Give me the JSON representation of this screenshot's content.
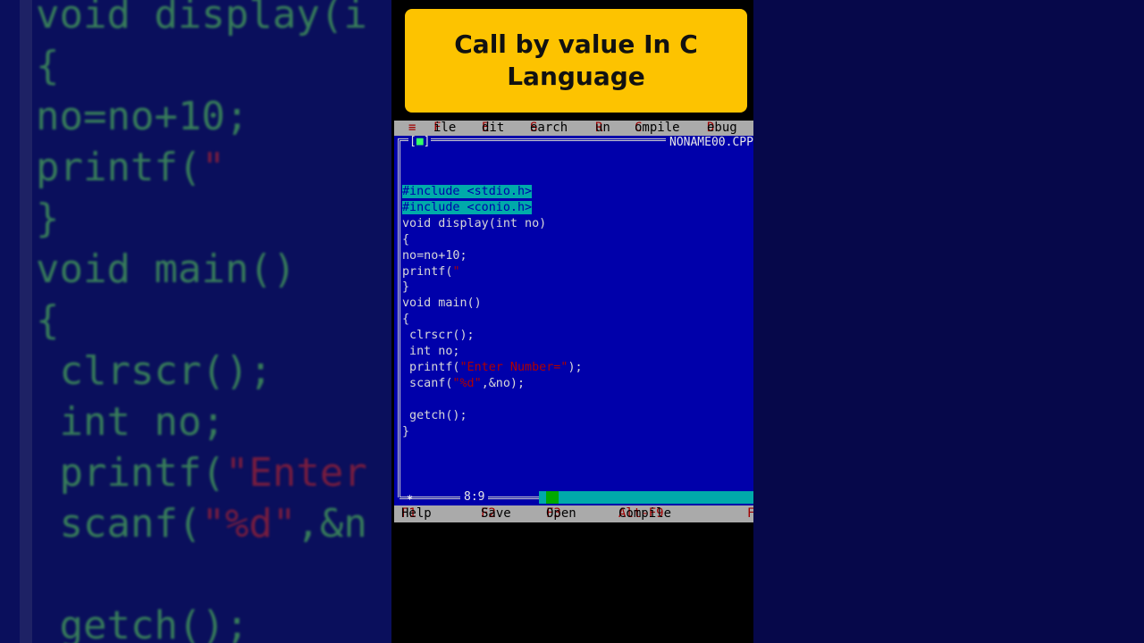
{
  "title_card": {
    "line1": "Call by value In C",
    "line2": "Language"
  },
  "menu": {
    "system": "≡",
    "items": [
      "File",
      "Edit",
      "Search",
      "Run",
      "Compile",
      "Debug"
    ]
  },
  "window": {
    "button": "[■]",
    "filename": "NONAME00.CPP"
  },
  "code": {
    "include1": "#include <stdio.h>",
    "include2": "#include <conio.h>",
    "l3": "void display(int no)",
    "l4": "{",
    "l5": "no=no+10;",
    "l6a": "printf(",
    "l6b": "\"",
    "l7": "}",
    "l8": "void main()",
    "l9": "{",
    "l10": " clrscr();",
    "l11": " int no;",
    "l12a": " printf(",
    "l12b": "\"Enter Number=\"",
    "l12c": ");",
    "l13a": " scanf(",
    "l13b": "\"%d\"",
    "l13c": ",&no);",
    "l14": "",
    "l15": " getch();",
    "l16": "}"
  },
  "status": {
    "cursor": "8:9",
    "marker": "*"
  },
  "footer": {
    "items": [
      {
        "key": "F1",
        "label": "Help"
      },
      {
        "key": "F2",
        "label": "Save"
      },
      {
        "key": "F3",
        "label": "Open"
      },
      {
        "key": "Alt-F9",
        "label": "Compile"
      },
      {
        "key": "F",
        "label": ""
      }
    ]
  },
  "background_code": {
    "b1": "void display(i",
    "b2": "{",
    "b3": "no=no+10;",
    "b4a": "printf(",
    "b4b": "\"",
    "b5": "}",
    "b6": "void main()",
    "b7": "{",
    "b8": " clrscr();",
    "b9": " int no;",
    "b10a": " printf(",
    "b10b": "\"Enter",
    "b11a": " scanf(",
    "b11b": "\"%d\"",
    "b11c": ",&n",
    "b12": "",
    "b13": " getch();"
  },
  "colors": {
    "ide_bg": "#0000aa",
    "menu_bg": "#aaaaaa",
    "hotkey": "#a00000",
    "title_bg": "#fdc300"
  }
}
